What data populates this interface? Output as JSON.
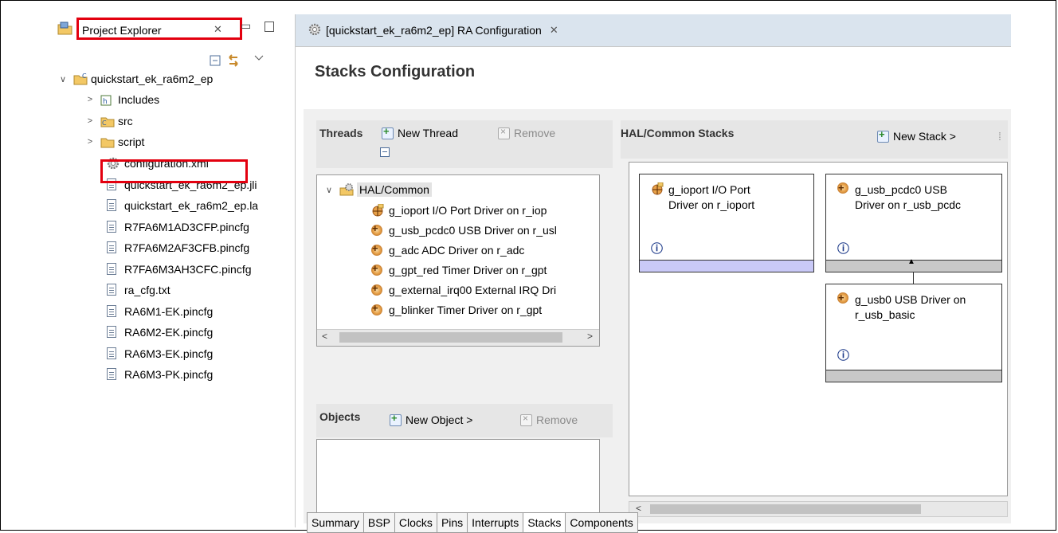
{
  "project_explorer": {
    "title": "Project Explorer",
    "close_glyph": "✕",
    "tree": {
      "root": "quickstart_ek_ra6m2_ep",
      "folders": [
        "Includes",
        "src",
        "script"
      ],
      "files": [
        "configuration.xml",
        "quickstart_ek_ra6m2_ep.jli",
        "quickstart_ek_ra6m2_ep.la",
        "R7FA6M1AD3CFP.pincfg",
        "R7FA6M2AF3CFB.pincfg",
        "R7FA6M3AH3CFC.pincfg",
        "ra_cfg.txt",
        "RA6M1-EK.pincfg",
        "RA6M2-EK.pincfg",
        "RA6M3-EK.pincfg",
        "RA6M3-PK.pincfg"
      ]
    }
  },
  "editor": {
    "tab_title": "[quickstart_ek_ra6m2_ep] RA Configuration",
    "close_glyph": "✕",
    "page_title": "Stacks Configuration",
    "threads": {
      "label": "Threads",
      "new_button": "New Thread",
      "remove_button": "Remove",
      "group": "HAL/Common",
      "items": [
        "g_ioport I/O Port Driver on r_iop",
        "g_usb_pcdc0 USB Driver on r_usl",
        "g_adc ADC Driver on r_adc",
        "g_gpt_red Timer Driver on r_gpt",
        "g_external_irq00 External IRQ Dri",
        "g_blinker Timer Driver on r_gpt"
      ]
    },
    "objects": {
      "label": "Objects",
      "new_button": "New Object >",
      "remove_button": "Remove"
    },
    "hal_stacks": {
      "label": "HAL/Common Stacks",
      "new_button": "New Stack >",
      "cards": [
        {
          "line1": "g_ioport I/O Port",
          "line2": "Driver on r_ioport",
          "footer_color": "#c9c9f7"
        },
        {
          "line1": "g_usb_pcdc0 USB",
          "line2": "Driver on r_usb_pcdc",
          "footer_color": "#c8c8c8"
        },
        {
          "line1": "g_usb0 USB Driver on",
          "line2": "r_usb_basic",
          "footer_color": "#c8c8c8"
        }
      ],
      "info_glyph": "ⓘ"
    },
    "bottom_tabs": [
      "Summary",
      "BSP",
      "Clocks",
      "Pins",
      "Interrupts",
      "Stacks",
      "Components"
    ],
    "active_bottom_tab": "Stacks"
  }
}
